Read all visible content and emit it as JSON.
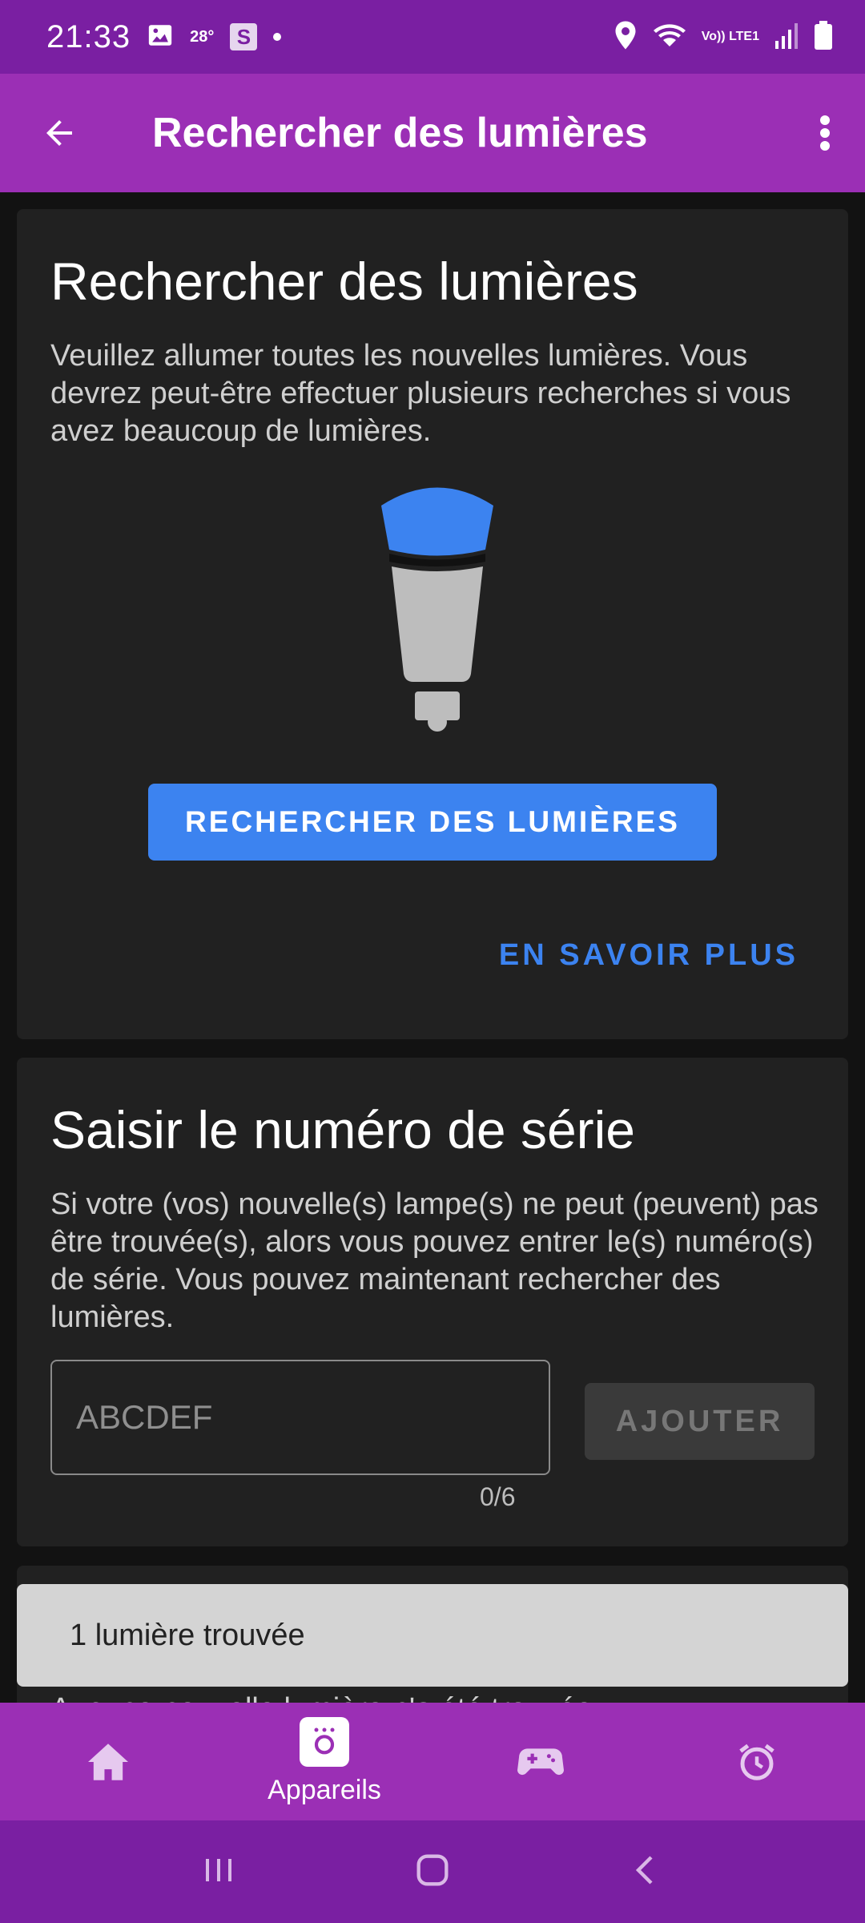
{
  "status_bar": {
    "time": "21:33",
    "temperature": "28°",
    "s_label": "S",
    "volte": "Vo)) LTE1"
  },
  "app_bar": {
    "title": "Rechercher des lumières"
  },
  "search_card": {
    "title": "Rechercher des lumières",
    "description": "Veuillez allumer toutes les nouvelles lumières. Vous devrez peut-être effectuer plusieurs recherches si vous avez beaucoup de lumières.",
    "search_button": "RECHERCHER DES LUMIÈRES",
    "learn_more": "EN SAVOIR PLUS"
  },
  "serial_card": {
    "title": "Saisir le numéro de série",
    "description": "Si votre (vos) nouvelle(s) lampe(s) ne peut (peuvent) pas être trouvée(s), alors vous pouvez entrer le(s) numéro(s) de série. Vous pouvez maintenant rechercher des lumières.",
    "input_placeholder": "ABCDEF",
    "input_value": "",
    "counter": "0/6",
    "add_button": "AJOUTER"
  },
  "snackbar": {
    "text": "1 lumière trouvée"
  },
  "behind_text": "Aucune nouvelle lumière n'a été trouvée",
  "bottom_nav": {
    "items": [
      {
        "icon": "home-icon",
        "label": ""
      },
      {
        "icon": "devices-icon",
        "label": "Appareils",
        "active": true
      },
      {
        "icon": "gamepad-icon",
        "label": ""
      },
      {
        "icon": "alarm-icon",
        "label": ""
      }
    ]
  },
  "colors": {
    "status_bar": "#7a1fa2",
    "app_bar": "#9b2fb5",
    "accent": "#3c83f0",
    "card": "#212121",
    "background": "#121212"
  }
}
